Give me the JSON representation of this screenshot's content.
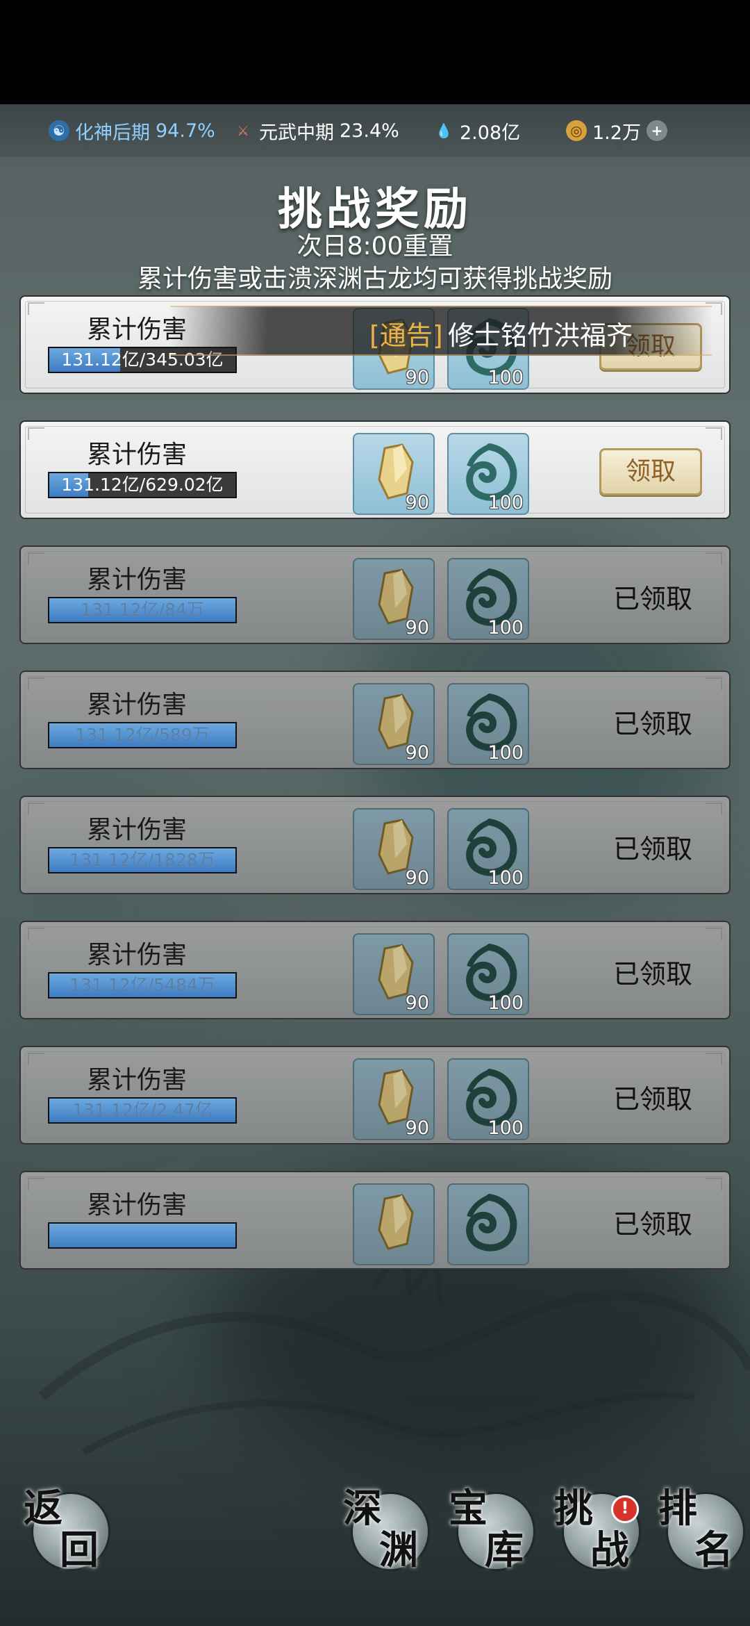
{
  "status_bar": {
    "realm1": {
      "label": "化神后期",
      "value": "94.7%"
    },
    "realm2": {
      "label": "元武中期",
      "value": "23.4%"
    },
    "spirit_stones": "2.08亿",
    "coins": "1.2万",
    "icons": [
      "blue-swirl-icon",
      "sword-emblem-icon",
      "water-drop-icon",
      "gold-coin-icon",
      "plus-icon"
    ]
  },
  "header": {
    "title": "挑战奖励",
    "reset_time": "次日8:00重置",
    "description": "累计伤害或击溃深渊古龙均可获得挑战奖励"
  },
  "notice": {
    "tag": "[通告]",
    "text": "修士铭竹洪福齐"
  },
  "rewards": [
    {
      "label": "累计伤害",
      "progress_text": "131.12亿/345.03亿",
      "progress_ratio": 0.38,
      "crystal_qty": "90",
      "jade_qty": "100",
      "state": "claimable",
      "button": "领取"
    },
    {
      "label": "累计伤害",
      "progress_text": "131.12亿/629.02亿",
      "progress_ratio": 0.21,
      "crystal_qty": "90",
      "jade_qty": "100",
      "state": "claimable",
      "button": "领取"
    },
    {
      "label": "累计伤害",
      "progress_text": "131.12亿/84万",
      "progress_ratio": 1,
      "crystal_qty": "90",
      "jade_qty": "100",
      "state": "claimed",
      "status": "已领取"
    },
    {
      "label": "累计伤害",
      "progress_text": "131.12亿/589万",
      "progress_ratio": 1,
      "crystal_qty": "90",
      "jade_qty": "100",
      "state": "claimed",
      "status": "已领取"
    },
    {
      "label": "累计伤害",
      "progress_text": "131.12亿/1828万",
      "progress_ratio": 1,
      "crystal_qty": "90",
      "jade_qty": "100",
      "state": "claimed",
      "status": "已领取"
    },
    {
      "label": "累计伤害",
      "progress_text": "131.12亿/5484万",
      "progress_ratio": 1,
      "crystal_qty": "90",
      "jade_qty": "100",
      "state": "claimed",
      "status": "已领取"
    },
    {
      "label": "累计伤害",
      "progress_text": "131.12亿/2.47亿",
      "progress_ratio": 1,
      "crystal_qty": "90",
      "jade_qty": "100",
      "state": "claimed",
      "status": "已领取"
    },
    {
      "label": "累计伤害",
      "progress_text": "",
      "progress_ratio": 1,
      "crystal_qty": "",
      "jade_qty": "",
      "state": "claimed",
      "status": "已领取"
    }
  ],
  "bottom_nav": {
    "back": {
      "c1": "返",
      "c2": "回"
    },
    "abyss": {
      "c1": "深",
      "c2": "渊"
    },
    "treasury": {
      "c1": "宝",
      "c2": "库"
    },
    "challenge": {
      "c1": "挑",
      "c2": "战",
      "badge": "!"
    },
    "ranking": {
      "c1": "排",
      "c2": "名"
    }
  },
  "colors": {
    "accent_gold": "#e8b545",
    "progress_blue": "#3d7cc3",
    "claim_text": "#8f5f26"
  }
}
